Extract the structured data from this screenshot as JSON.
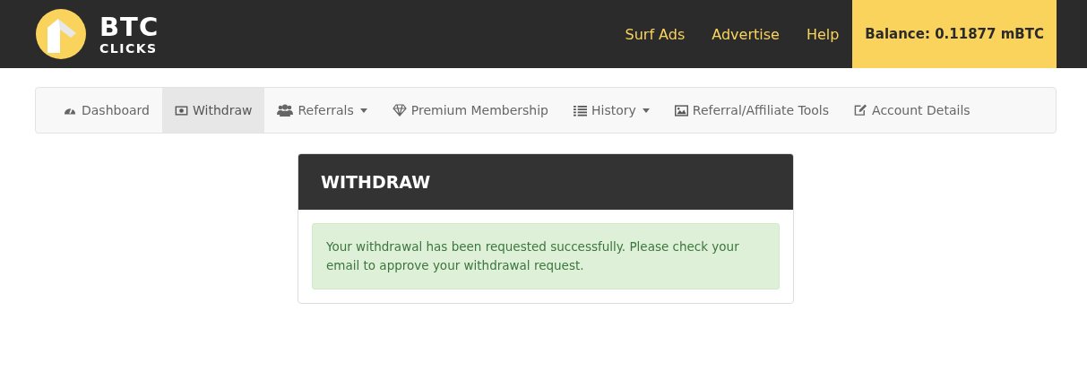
{
  "logo": {
    "line1": "BTC",
    "line2": "CLICKS"
  },
  "top_links": [
    "Surf Ads",
    "Advertise",
    "Help"
  ],
  "balance": "Balance: 0.11877 mBTC",
  "nav": [
    {
      "kind": "gauge",
      "label": "Dashboard",
      "dropdown": false,
      "selected": false
    },
    {
      "kind": "money",
      "label": "Withdraw",
      "dropdown": false,
      "selected": true
    },
    {
      "kind": "users",
      "label": "Referrals",
      "dropdown": true,
      "selected": false
    },
    {
      "kind": "diamond",
      "label": "Premium Membership",
      "dropdown": false,
      "selected": false
    },
    {
      "kind": "list",
      "label": "History",
      "dropdown": true,
      "selected": false
    },
    {
      "kind": "image",
      "label": "Referral/Affiliate Tools",
      "dropdown": false,
      "selected": false
    },
    {
      "kind": "edit",
      "label": "Account Details",
      "dropdown": false,
      "selected": false
    }
  ],
  "panel": {
    "title": "WITHDRAW",
    "alert": "Your withdrawal has been requested successfully. Please check your email to approve your withdrawal request."
  }
}
